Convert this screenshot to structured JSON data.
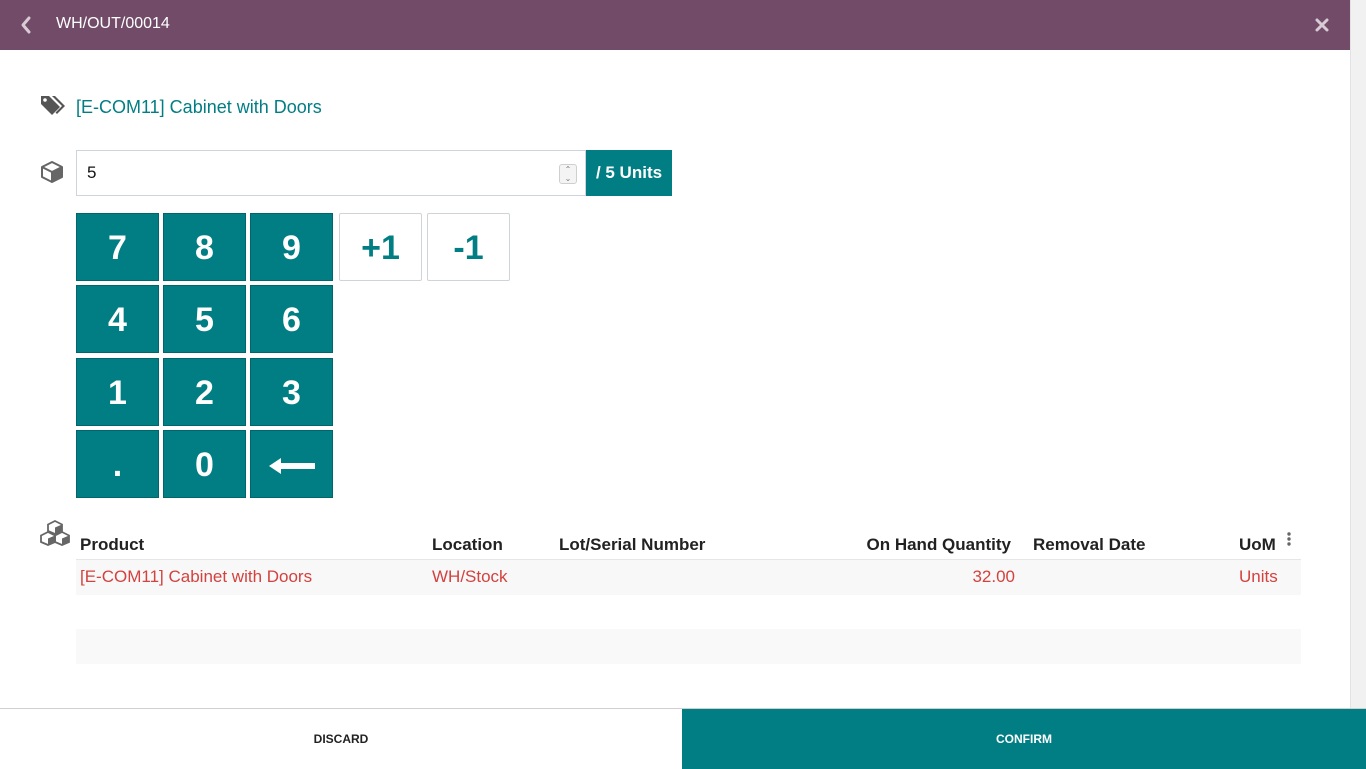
{
  "header": {
    "title": "WH/OUT/00014",
    "back_icon": "chevron-left-icon",
    "close_icon": "close-icon"
  },
  "product": {
    "name": "[E-COM11] Cabinet with Doors",
    "icon": "tags-icon"
  },
  "quantity": {
    "value": "5",
    "unit_label": "/ 5 Units",
    "icon": "cube-icon"
  },
  "keypad": {
    "keys": [
      "7",
      "8",
      "9",
      "4",
      "5",
      "6",
      "1",
      "2",
      "3",
      ".",
      "0"
    ],
    "plus_one": "+1",
    "minus_one": "-1",
    "backspace_icon": "arrow-left-icon"
  },
  "table": {
    "icon": "cubes-icon",
    "headers": [
      "Product",
      "Location",
      "Lot/Serial Number",
      "On Hand Quantity",
      "Removal Date",
      "UoM"
    ],
    "rows": [
      {
        "product": "[E-COM11] Cabinet with Doors",
        "location": "WH/Stock",
        "lot": "",
        "on_hand": "32.00",
        "removal_date": "",
        "uom": "Units"
      }
    ]
  },
  "footer": {
    "discard": "DISCARD",
    "confirm": "CONFIRM"
  },
  "colors": {
    "header_bg": "#714b67",
    "accent": "#017e84",
    "row_text": "#d2423f"
  }
}
